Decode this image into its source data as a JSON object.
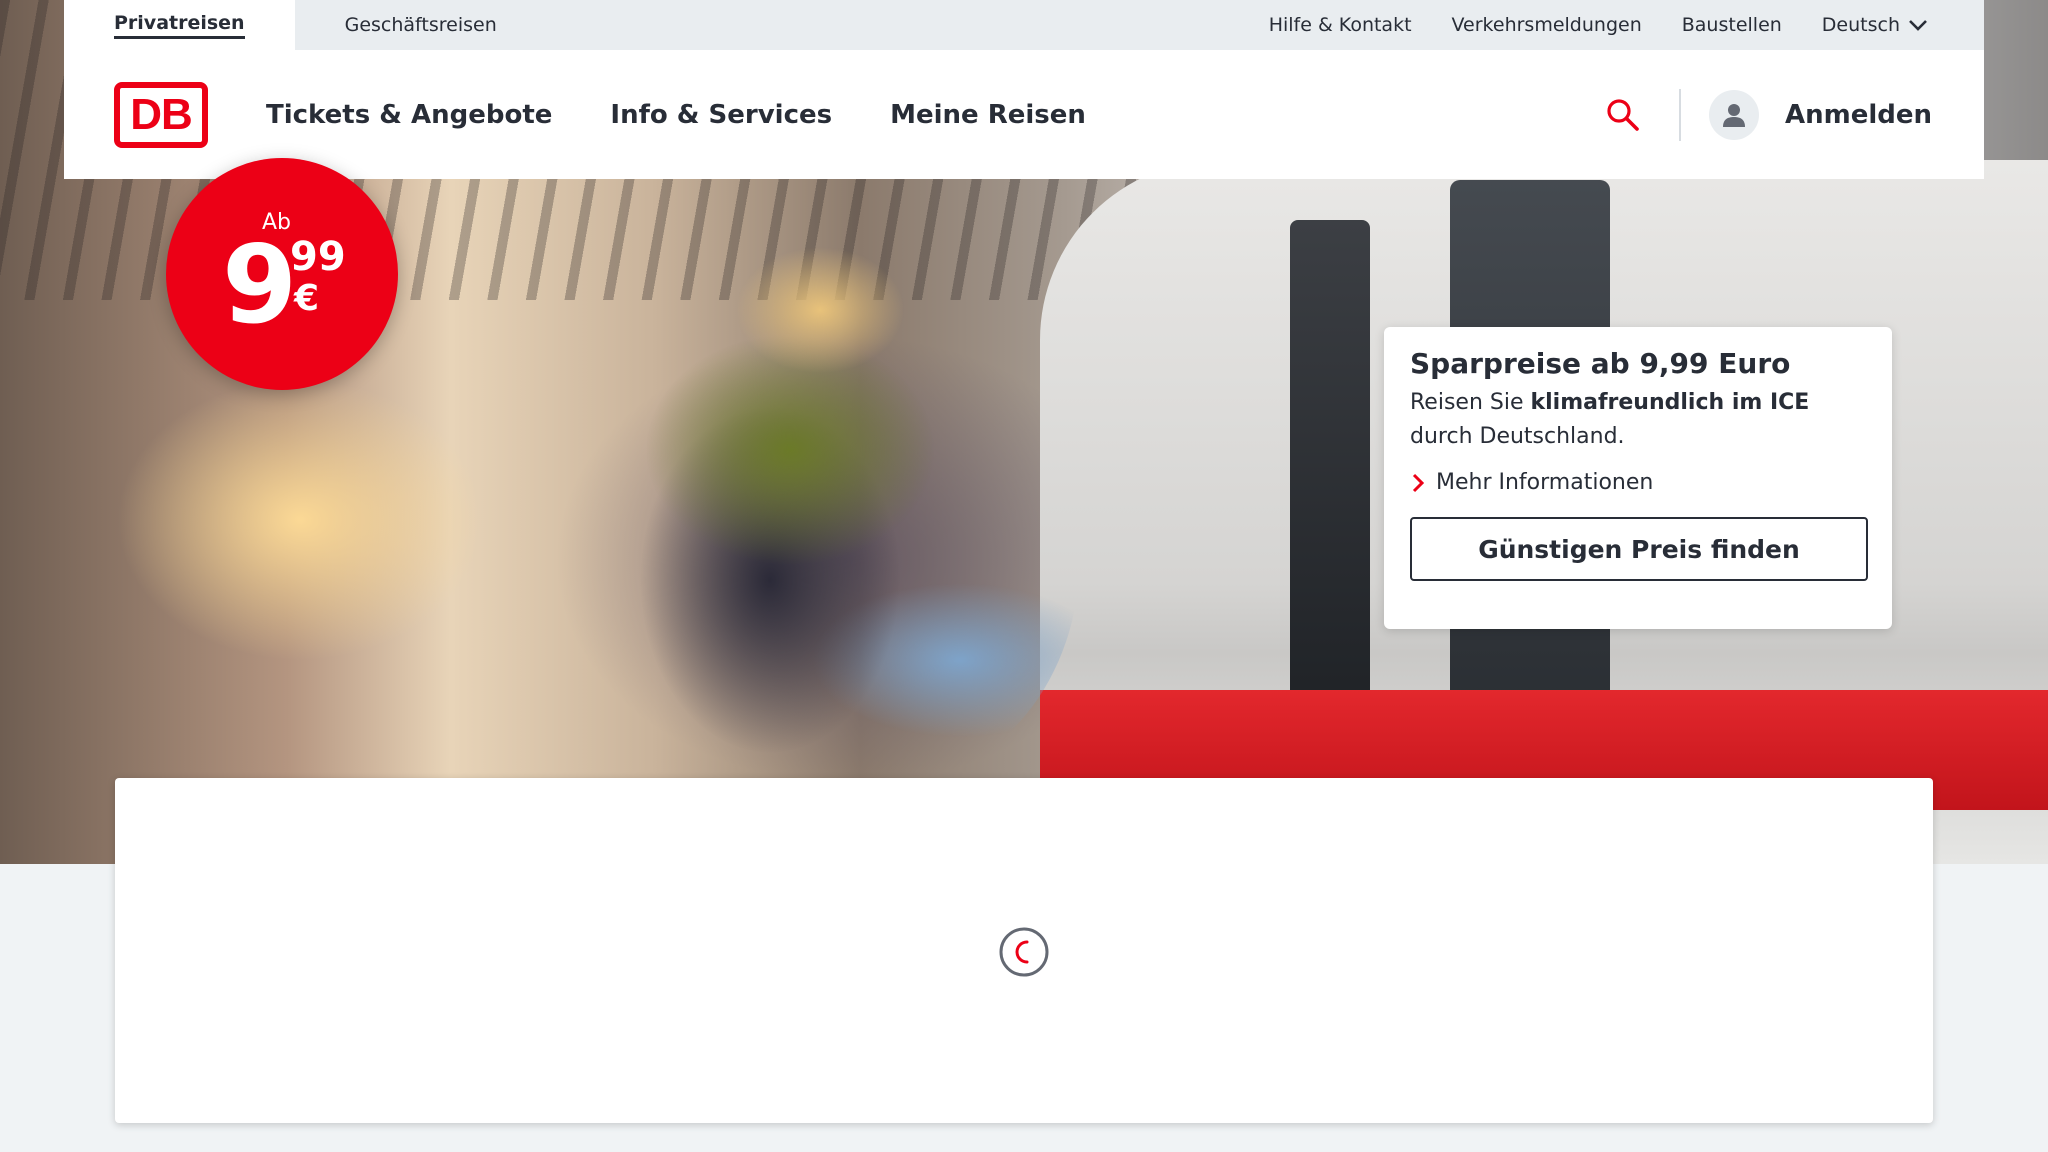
{
  "meta_nav": {
    "tabs": [
      {
        "label": "Privatreisen",
        "active": true
      },
      {
        "label": "Geschäftsreisen",
        "active": false
      }
    ],
    "links": [
      "Hilfe & Kontakt",
      "Verkehrsmeldungen",
      "Baustellen"
    ],
    "language": "Deutsch"
  },
  "header": {
    "logo_text": "DB",
    "nav": [
      "Tickets & Angebote",
      "Info & Services",
      "Meine Reisen"
    ],
    "login_label": "Anmelden",
    "icons": {
      "search": "search-icon",
      "user": "user-icon"
    }
  },
  "badge": {
    "prefix": "Ab",
    "euros": "9",
    "cents": "99",
    "currency": "€"
  },
  "teaser": {
    "title": "Sparpreise ab 9,99 Euro",
    "text_before": "Reisen Sie ",
    "text_bold": "klimafreundlich im ICE",
    "text_after": " durch Deutschland.",
    "more_link": "Mehr Informationen",
    "cta": "Günstigen Preis finden"
  },
  "colors": {
    "brand_red": "#ec0016",
    "text": "#282d37",
    "meta_bg": "#e9edf0",
    "page_bg": "#f0f3f5"
  }
}
